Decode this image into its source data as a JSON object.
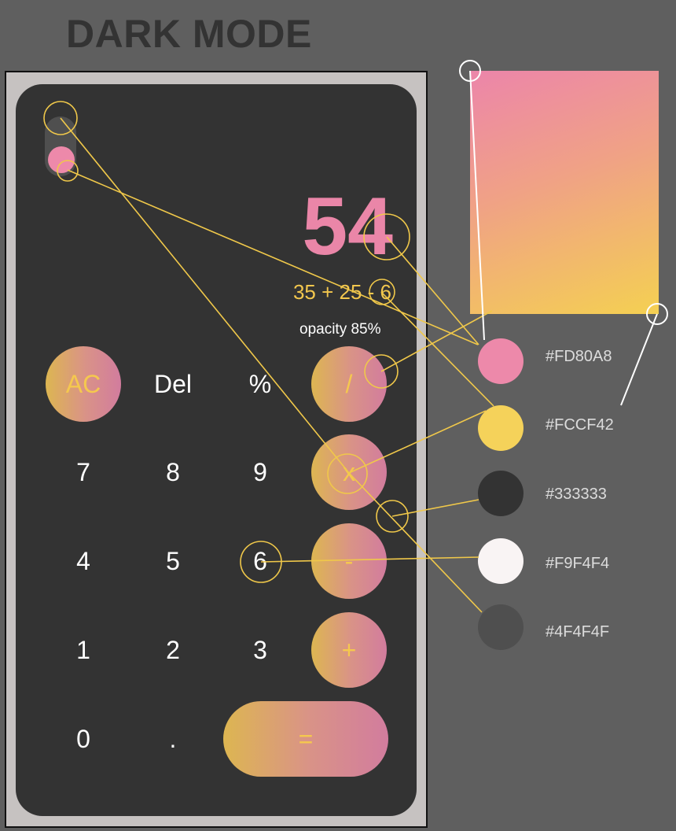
{
  "title": "DARK MODE",
  "display": {
    "result": "54",
    "expression": "35 + 25 - 6",
    "opacity_label": "opacity 85%"
  },
  "keys": {
    "ac": "AC",
    "del": "Del",
    "percent": "%",
    "divide": "/",
    "seven": "7",
    "eight": "8",
    "nine": "9",
    "multiply": "x",
    "four": "4",
    "five": "5",
    "six": "6",
    "minus": "-",
    "one": "1",
    "two": "2",
    "three": "3",
    "plus": "+",
    "zero": "0",
    "decimal": ".",
    "equals": "="
  },
  "palette": [
    {
      "hex": "#FD80A8",
      "color": "#ed89aa"
    },
    {
      "hex": "#FCCF42",
      "color": "#f5d25a"
    },
    {
      "hex": "#333333",
      "color": "#333333"
    },
    {
      "hex": "#F9F4F4",
      "color": "#f9f4f4"
    },
    {
      "hex": "#4F4F4F",
      "color": "#4f4f4f"
    }
  ],
  "colors": {
    "page_background": "#5f5f5f",
    "phone_frame": "#c6c2c1",
    "screen": "#333333",
    "accent_pink": "#ea86a8",
    "accent_yellow": "#f5c84e",
    "annotation_yellow": "#f0c84a",
    "annotation_white": "#ffffff"
  }
}
